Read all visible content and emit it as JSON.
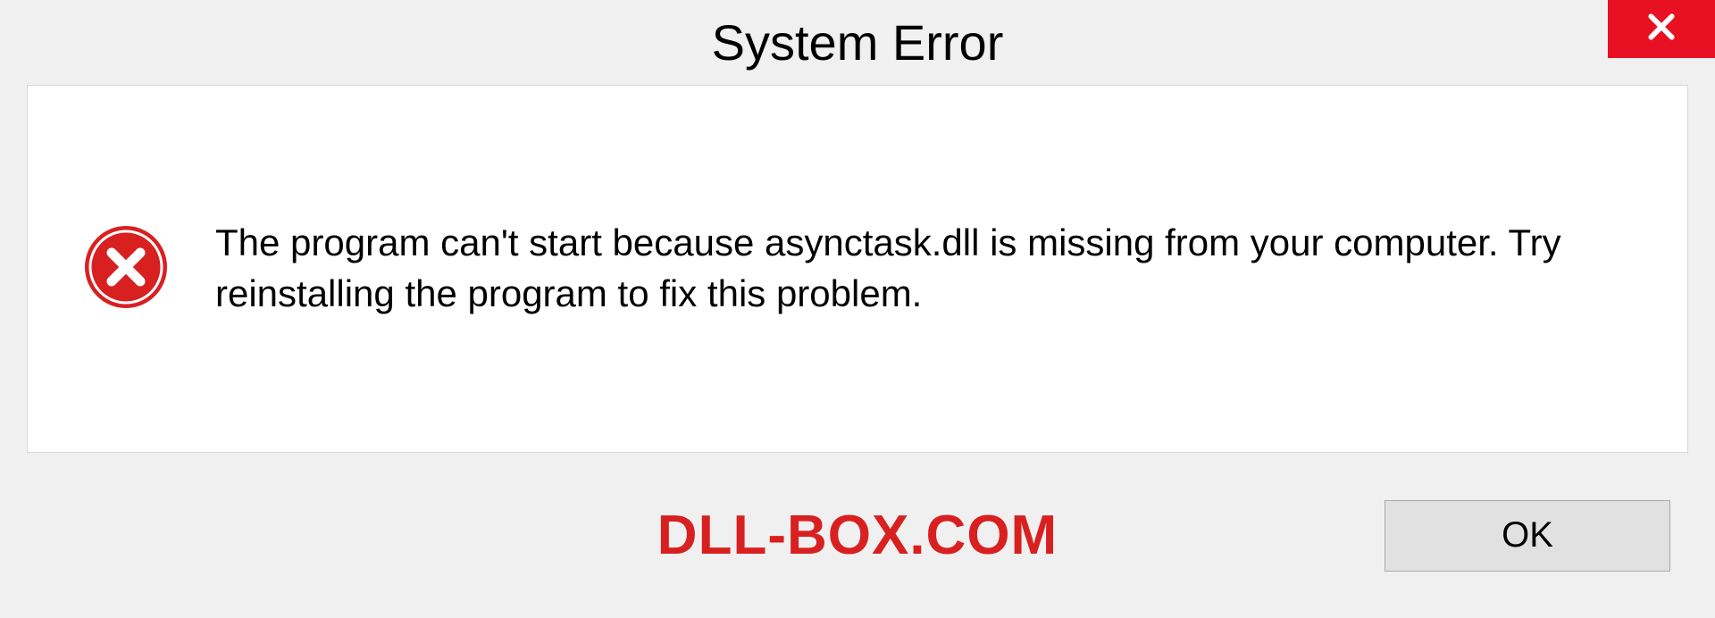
{
  "dialog": {
    "title": "System Error",
    "message": "The program can't start because asynctask.dll is missing from your computer. Try reinstalling the program to fix this problem.",
    "ok_label": "OK"
  },
  "watermark": "DLL-BOX.COM",
  "colors": {
    "close_bg": "#e81123",
    "error_icon": "#d92020",
    "watermark": "#d92020"
  }
}
